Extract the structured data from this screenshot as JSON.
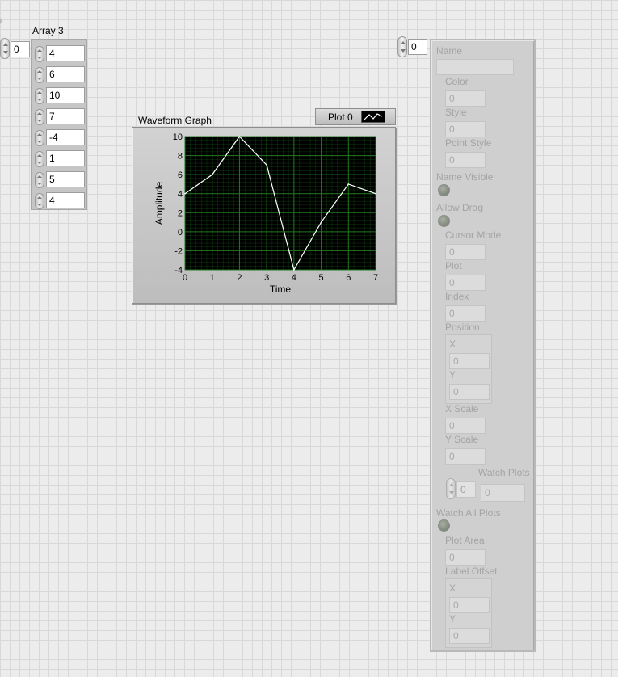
{
  "array": {
    "label": "Array 3",
    "index": "0",
    "elements": [
      "4",
      "6",
      "10",
      "7",
      "-4",
      "1",
      "5",
      "4"
    ]
  },
  "graph": {
    "label": "Waveform Graph",
    "legend_plot_name": "Plot 0"
  },
  "cluster_index": "0",
  "cluster": {
    "name_label": "Name",
    "name_value": "",
    "color_label": "Color",
    "color_value": "0",
    "style_label": "Style",
    "style_value": "0",
    "point_style_label": "Point Style",
    "point_style_value": "0",
    "name_visible_label": "Name Visible",
    "allow_drag_label": "Allow Drag",
    "cursor_mode_label": "Cursor Mode",
    "cursor_mode_value": "0",
    "plot_label": "Plot",
    "plot_value": "0",
    "index_label": "Index",
    "index_value": "0",
    "position_label": "Position",
    "position_x_label": "X",
    "position_x_value": "0",
    "position_y_label": "Y",
    "position_y_value": "0",
    "x_scale_label": "X Scale",
    "x_scale_value": "0",
    "y_scale_label": "Y Scale",
    "y_scale_value": "0",
    "watch_plots_label": "Watch Plots",
    "watch_plots_index": "0",
    "watch_plots_value": "0",
    "watch_all_plots_label": "Watch All Plots",
    "plot_area_label": "Plot Area",
    "plot_area_value": "0",
    "label_offset_label": "Label Offset",
    "label_offset_x_label": "X",
    "label_offset_x_value": "0",
    "label_offset_y_label": "Y",
    "label_offset_y_value": "0"
  },
  "colors": {
    "plot_background": "#000000",
    "grid": "#1f7a1f",
    "trace": "#ffffff"
  },
  "chart_data": {
    "type": "line",
    "x": [
      0,
      1,
      2,
      3,
      4,
      5,
      6,
      7
    ],
    "series": [
      {
        "name": "Plot 0",
        "values": [
          4,
          6,
          10,
          7,
          -4,
          1,
          5,
          4
        ]
      }
    ],
    "xlabel": "Time",
    "ylabel": "Amplitude",
    "xlim": [
      0,
      7
    ],
    "ylim": [
      -4,
      10
    ],
    "x_ticks": [
      "0",
      "1",
      "2",
      "3",
      "4",
      "5",
      "6",
      "7"
    ],
    "y_ticks": [
      "10",
      "8",
      "6",
      "4",
      "2",
      "0",
      "-2",
      "-4"
    ],
    "grid": true,
    "legend": "top-right"
  }
}
